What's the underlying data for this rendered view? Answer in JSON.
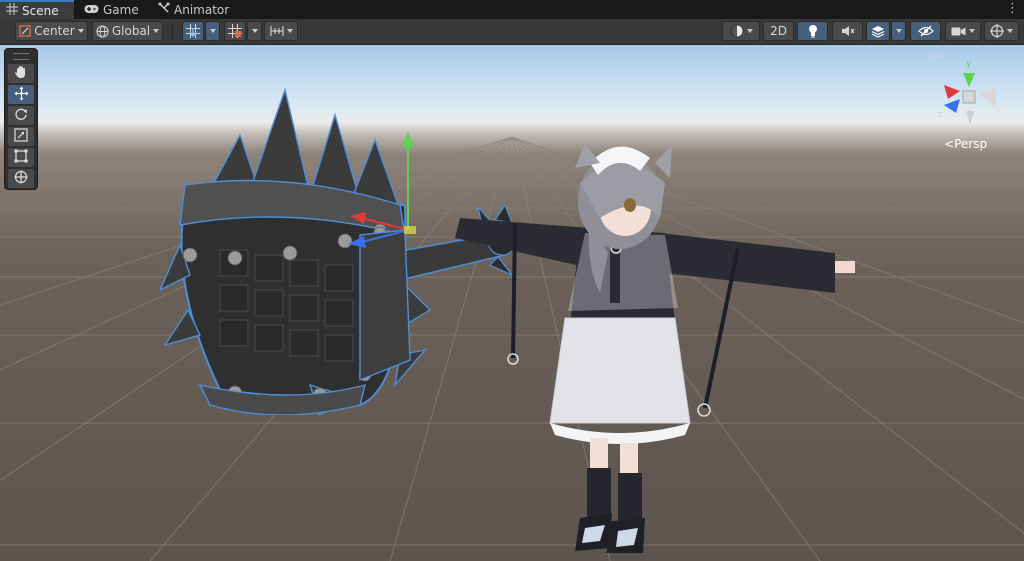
{
  "tabs": [
    {
      "label": "Scene",
      "icon": "grid-icon",
      "active": true
    },
    {
      "label": "Game",
      "icon": "gamepad-icon",
      "active": false
    },
    {
      "label": "Animator",
      "icon": "animator-icon",
      "active": false
    }
  ],
  "toolbar": {
    "pivot_label": "Center",
    "space_label": "Global",
    "mode_2d_label": "2D"
  },
  "viewport": {
    "camera_mode_label": "Persp"
  },
  "tools": [
    {
      "name": "hand-tool",
      "active": false
    },
    {
      "name": "move-tool",
      "active": true
    },
    {
      "name": "rotate-tool",
      "active": false
    },
    {
      "name": "scale-tool",
      "active": false
    },
    {
      "name": "rect-tool",
      "active": false
    },
    {
      "name": "transform-tool",
      "active": false
    }
  ],
  "colors": {
    "accent": "#3a79bb",
    "axis_x": "#e03a3a",
    "axis_y": "#5bd34a",
    "axis_z": "#3a6ef0",
    "selection_outline": "#4d8fd6"
  }
}
